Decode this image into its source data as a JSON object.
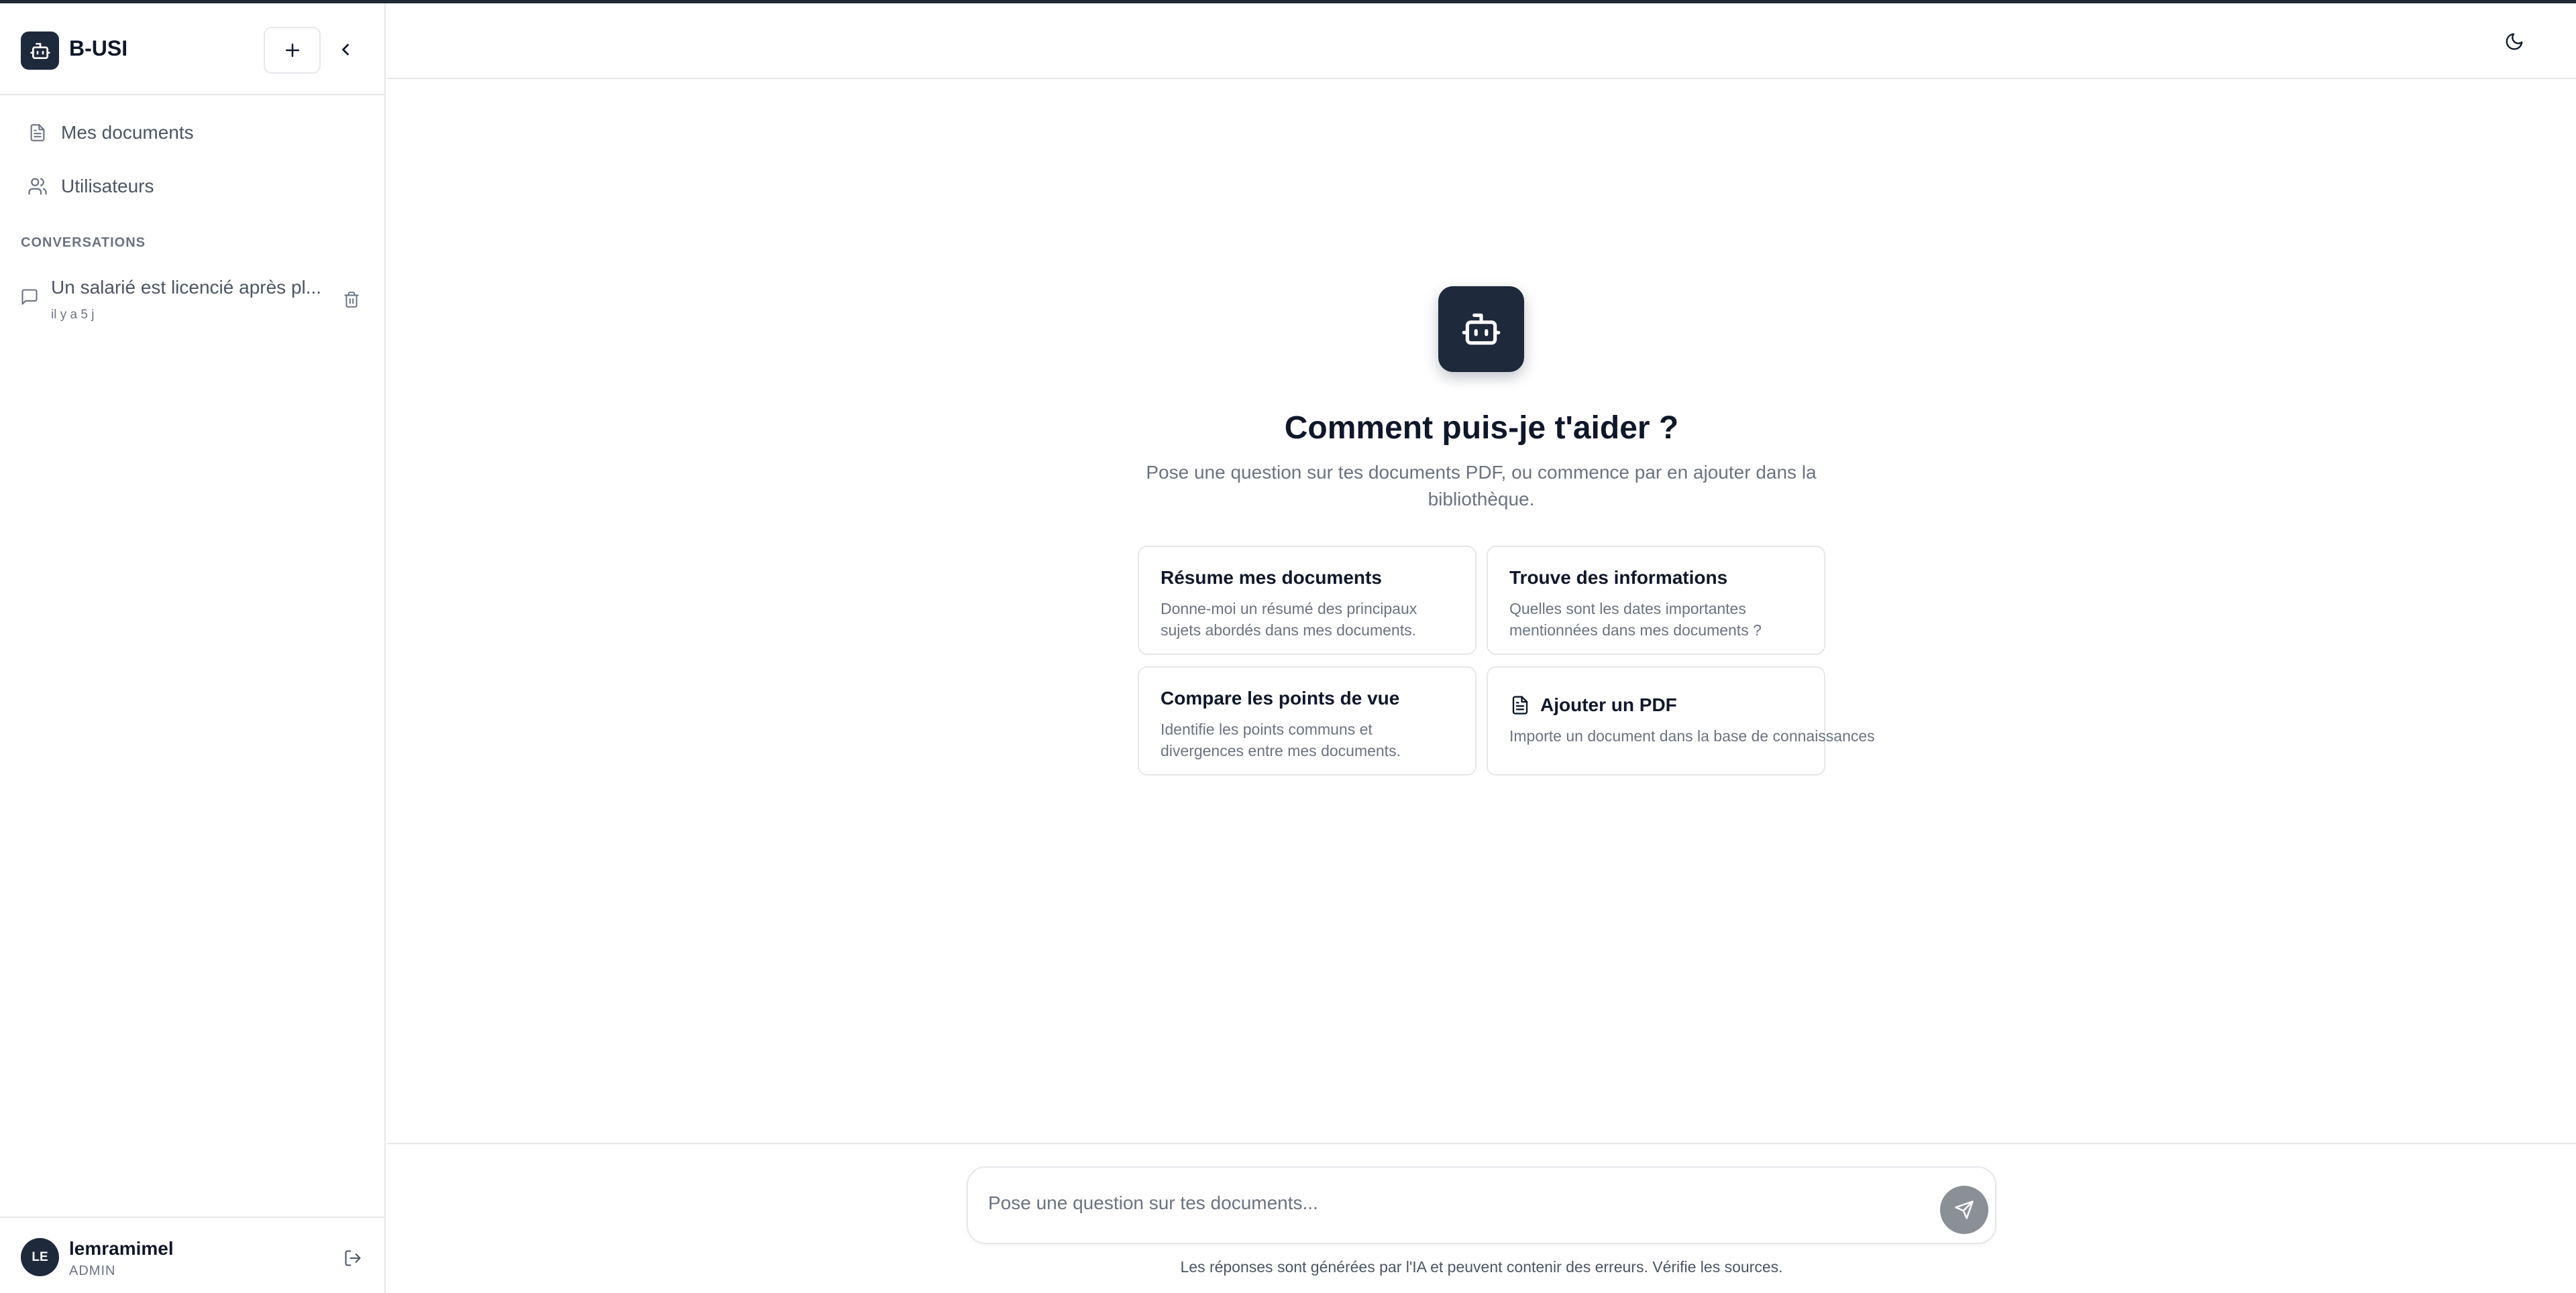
{
  "sidebar": {
    "brand": {
      "name": "B-USI",
      "icon": "bot-icon"
    },
    "new_chat_icon": "plus-icon",
    "collapse_icon": "chevron-left-icon",
    "nav": [
      {
        "label": "Mes documents",
        "icon": "file-text-icon"
      },
      {
        "label": "Utilisateurs",
        "icon": "users-icon"
      }
    ],
    "section_label": "CONVERSATIONS",
    "conversations": [
      {
        "title": "Un salarié est licencié après plusieurs absences",
        "title_display": "Un salarié est licencié après pl...",
        "time": "il y a 5 j",
        "icon": "message-square-icon",
        "delete_icon": "trash-icon"
      }
    ],
    "user": {
      "initials": "LE",
      "name": "lemramimel",
      "role": "ADMIN",
      "logout_icon": "log-out-icon"
    }
  },
  "topbar": {
    "theme_icon": "moon-icon"
  },
  "main": {
    "title": "Comment puis-je t'aider ?",
    "subtitle": "Pose une question sur tes documents PDF, ou commence par en ajouter dans la bibliothèque.",
    "suggestions": [
      {
        "title": "Résume mes documents",
        "desc": "Donne-moi un résumé des principaux sujets abordés dans mes documents."
      },
      {
        "title": "Trouve des informations",
        "desc": "Quelles sont les dates importantes mentionnées dans mes documents ?"
      },
      {
        "title": "Compare les points de vue",
        "desc": "Identifie les points communs et divergences entre mes documents."
      },
      {
        "title": "Ajouter un PDF",
        "desc": "Importe un document dans la base de connaissances",
        "icon": "file-text-icon"
      }
    ]
  },
  "composer": {
    "placeholder": "Pose une question sur tes documents...",
    "value": "",
    "send_icon": "send-icon"
  },
  "disclaimer": "Les réponses sont générées par l'IA et peuvent contenir des erreurs. Vérifie les sources.",
  "colors": {
    "brand_dark": "#1e293b",
    "border": "#e5e7eb",
    "muted_text": "#6b7280",
    "send_button": "#8b8f96"
  }
}
